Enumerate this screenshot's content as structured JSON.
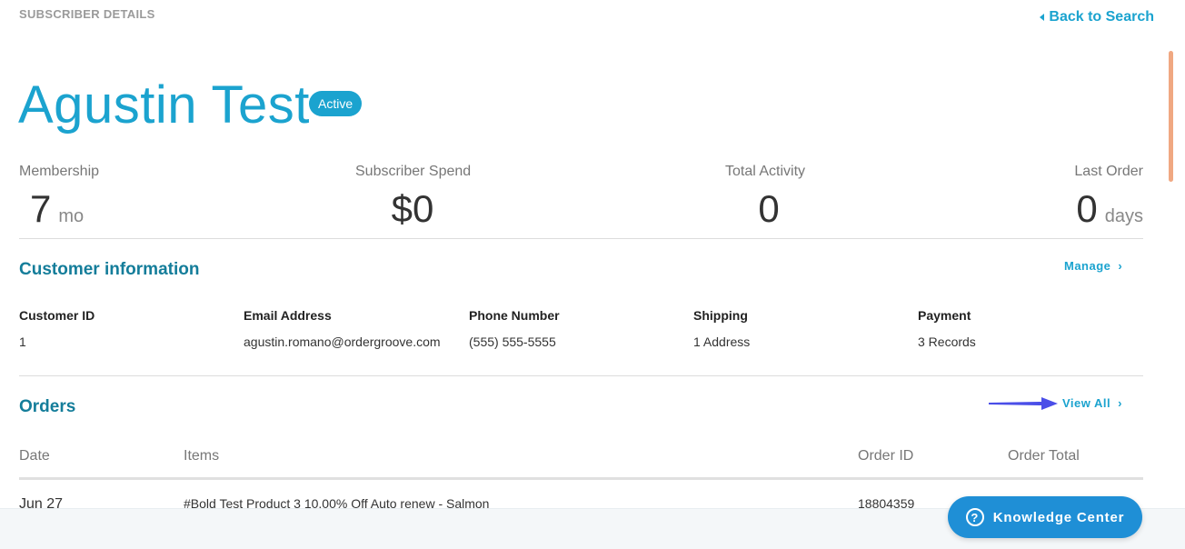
{
  "header": {
    "section_label": "SUBSCRIBER DETAILS",
    "back_link": "Back to Search",
    "name": "Agustin Test",
    "status_badge": "Active"
  },
  "stats": {
    "membership": {
      "label": "Membership",
      "value": "7",
      "unit": "mo"
    },
    "spend": {
      "label": "Subscriber Spend",
      "value": "$0"
    },
    "activity": {
      "label": "Total Activity",
      "value": "0"
    },
    "last_order": {
      "label": "Last Order",
      "value": "0",
      "unit": "days"
    }
  },
  "customer_info": {
    "title": "Customer information",
    "manage_link": "Manage",
    "fields": [
      {
        "key": "Customer ID",
        "value": "1"
      },
      {
        "key": "Email Address",
        "value": "agustin.romano@ordergroove.com"
      },
      {
        "key": "Phone Number",
        "value": "(555) 555-5555"
      },
      {
        "key": "Shipping",
        "value": "1 Address"
      },
      {
        "key": "Payment",
        "value": "3 Records"
      }
    ]
  },
  "orders": {
    "title": "Orders",
    "view_all_link": "View All",
    "columns": [
      "Date",
      "Items",
      "Order ID",
      "Order Total"
    ],
    "rows": [
      {
        "date": "Jun 27",
        "items": "#Bold Test Product 3 10.00% Off Auto renew - Salmon",
        "order_id": "18804359",
        "total": ""
      }
    ]
  },
  "help": {
    "label": "Knowledge Center"
  },
  "colors": {
    "accent": "#1ba3cf",
    "heading": "#147d9a",
    "button": "#1f8fd6",
    "arrow": "#4a4ee8"
  },
  "icons": {
    "back": "caret-left-icon",
    "chevron": "chevron-right-icon",
    "help": "question-circle-icon",
    "pointer": "arrow-right-icon"
  }
}
